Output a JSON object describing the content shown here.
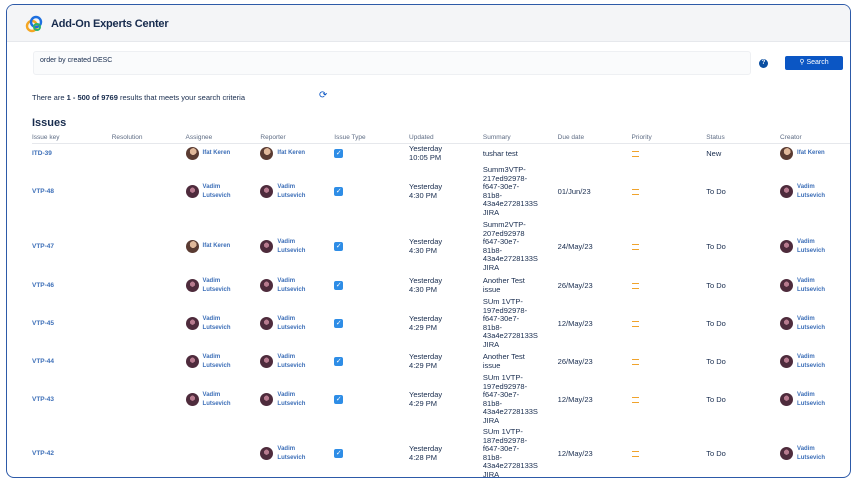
{
  "header": {
    "app_title": "Add-On Experts Center"
  },
  "search": {
    "query": "order by created DESC",
    "button_label": "Search"
  },
  "results": {
    "prefix": "There are ",
    "range": "1 - 500 of 9769",
    "suffix": " results that meets your search criteria"
  },
  "issues_title": "Issues",
  "columns": [
    "Issue key",
    "Resolution",
    "Assignee",
    "Reporter",
    "Issue Type",
    "Updated",
    "Summary",
    "Due date",
    "Priority",
    "Status",
    "Creator"
  ],
  "rows": [
    {
      "key": "ITD-39",
      "resolution": "",
      "assignee": "Ifat Keren",
      "reporter": "Ifat Keren",
      "updated": "Yesterday\n10:05 PM",
      "summary": "tushar test",
      "due": "",
      "status": "New",
      "creator": "Ifat Keren"
    },
    {
      "key": "VTP-48",
      "resolution": "",
      "assignee": "Vadim\nLutsevich",
      "reporter": "Vadim\nLutsevich",
      "updated": "Yesterday\n4:30 PM",
      "summary": "Summ3VTP-\n217ed92978-\nf647-30e7-\n81b8-\n43a4e2728133S\nJIRA",
      "due": "01/Jun/23",
      "status": "To Do",
      "creator": "Vadim\nLutsevich"
    },
    {
      "key": "VTP-47",
      "resolution": "",
      "assignee": "Ifat Keren",
      "reporter": "Vadim\nLutsevich",
      "updated": "Yesterday\n4:30 PM",
      "summary": "Summ2VTP-\n207ed92978\nf647-30e7-\n81b8-\n43a4e2728133S\nJIRA",
      "due": "24/May/23",
      "status": "To Do",
      "creator": "Vadim\nLutsevich"
    },
    {
      "key": "VTP-46",
      "resolution": "",
      "assignee": "Vadim\nLutsevich",
      "reporter": "Vadim\nLutsevich",
      "updated": "Yesterday\n4:30 PM",
      "summary": "Another Test\nissue",
      "due": "26/May/23",
      "status": "To Do",
      "creator": "Vadim\nLutsevich"
    },
    {
      "key": "VTP-45",
      "resolution": "",
      "assignee": "Vadim\nLutsevich",
      "reporter": "Vadim\nLutsevich",
      "updated": "Yesterday\n4:29 PM",
      "summary": "SUm 1VTP-\n197ed92978-\nf647-30e7-\n81b8-\n43a4e2728133S\nJIRA",
      "due": "12/May/23",
      "status": "To Do",
      "creator": "Vadim\nLutsevich"
    },
    {
      "key": "VTP-44",
      "resolution": "",
      "assignee": "Vadim\nLutsevich",
      "reporter": "Vadim\nLutsevich",
      "updated": "Yesterday\n4:29 PM",
      "summary": "Another Test\nissue",
      "due": "26/May/23",
      "status": "To Do",
      "creator": "Vadim\nLutsevich"
    },
    {
      "key": "VTP-43",
      "resolution": "",
      "assignee": "Vadim\nLutsevich",
      "reporter": "Vadim\nLutsevich",
      "updated": "Yesterday\n4:29 PM",
      "summary": "SUm 1VTP-\n197ed92978-\nf647-30e7-\n81b8-\n43a4e2728133S\nJIRA",
      "due": "12/May/23",
      "status": "To Do",
      "creator": "Vadim\nLutsevich"
    },
    {
      "key": "VTP-42",
      "resolution": "",
      "assignee": "",
      "reporter": "Vadim\nLutsevich",
      "updated": "Yesterday\n4:28 PM",
      "summary": "SUm 1VTP-\n187ed92978-\nf647-30e7-\n81b8-\n43a4e2728133S\nJIRA",
      "due": "12/May/23",
      "status": "To Do",
      "creator": "Vadim\nLutsevich"
    }
  ]
}
